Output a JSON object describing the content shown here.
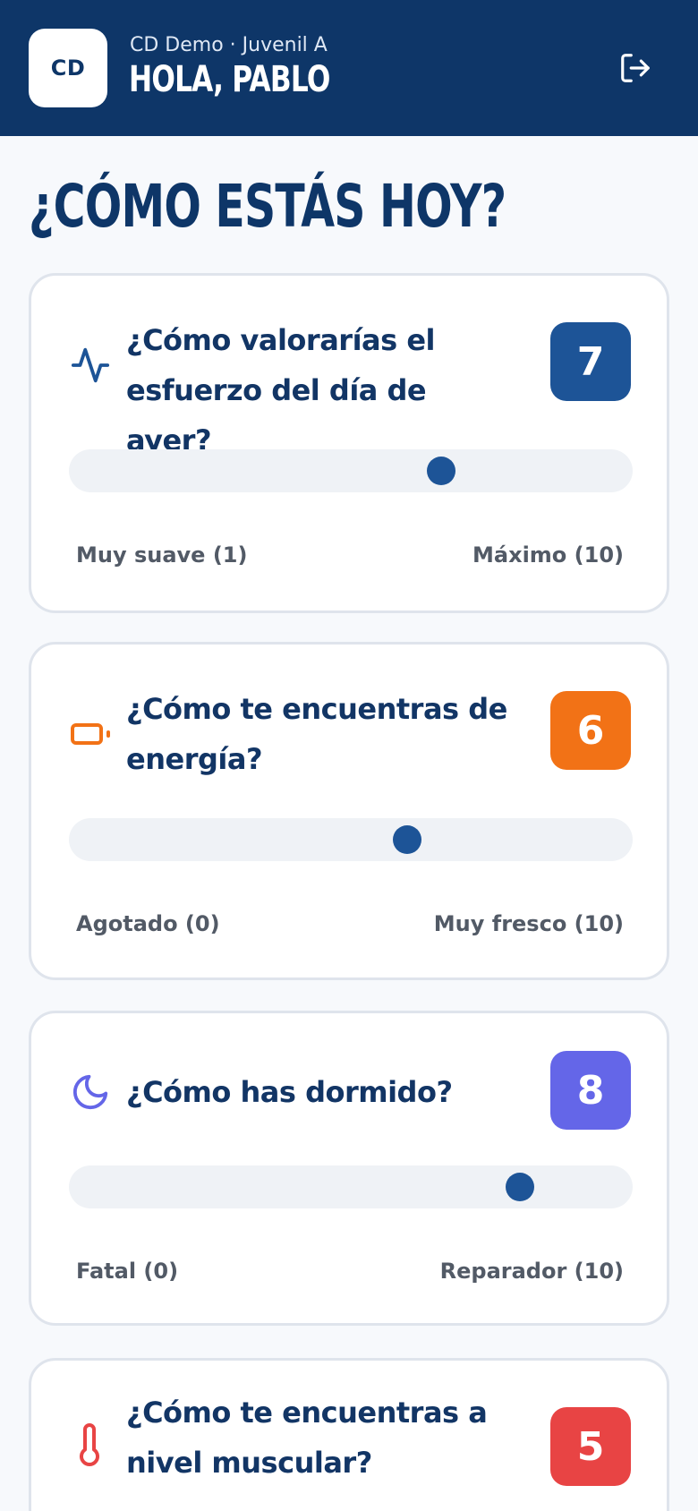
{
  "header": {
    "logo_text": "CD",
    "club_line": "CD Demo · Juvenil A",
    "greeting": "HOLA, PABLO",
    "logout_icon": "logout-icon"
  },
  "page": {
    "title": "¿CÓMO ESTÁS HOY?"
  },
  "colors": {
    "header_bg": "#0e3668",
    "slider_thumb": "#1d5497",
    "effort": "#1d5497",
    "energy": "#f27216",
    "sleep": "#6466e8",
    "muscle": "#e84444"
  },
  "questions": [
    {
      "id": "effort",
      "icon": "activity-icon",
      "question": "¿Cómo valorarías el esfuerzo del día de ayer?",
      "value": "7",
      "level": 0.66,
      "min_label": "Muy suave (1)",
      "max_label": "Máximo (10)"
    },
    {
      "id": "energy",
      "icon": "battery-icon",
      "question": "¿Cómo te encuentras de energía?",
      "value": "6",
      "level": 0.6,
      "min_label": "Agotado (0)",
      "max_label": "Muy fresco (10)"
    },
    {
      "id": "sleep",
      "icon": "moon-icon",
      "question": "¿Cómo has dormido?",
      "value": "8",
      "level": 0.8,
      "min_label": "Fatal (0)",
      "max_label": "Reparador (10)"
    },
    {
      "id": "muscle",
      "icon": "thermometer-icon",
      "question": "¿Cómo te encuentras a nivel muscular?",
      "value": "5"
    }
  ]
}
